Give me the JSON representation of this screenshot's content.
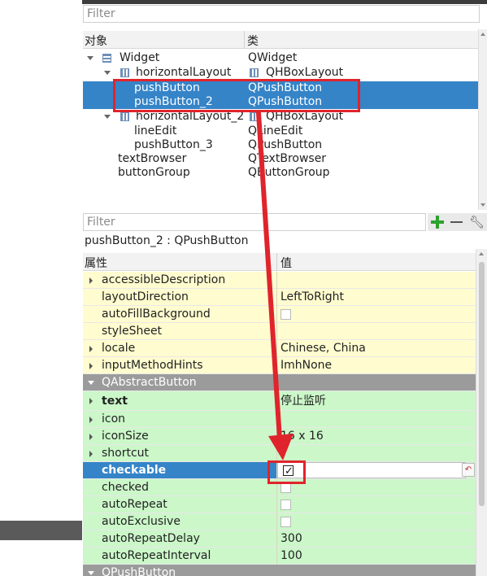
{
  "object_inspector": {
    "filter_placeholder": "Filter",
    "col_object": "对象",
    "col_class": "类",
    "rows": [
      {
        "name": "Widget",
        "cls": "QWidget"
      },
      {
        "name": "horizontalLayout",
        "cls": "QHBoxLayout"
      },
      {
        "name": "pushButton",
        "cls": "QPushButton"
      },
      {
        "name": "pushButton_2",
        "cls": "QPushButton"
      },
      {
        "name": "horizontalLayout_2",
        "cls": "QHBoxLayout"
      },
      {
        "name": "lineEdit",
        "cls": "QLineEdit"
      },
      {
        "name": "pushButton_3",
        "cls": "QPushButton"
      },
      {
        "name": "textBrowser",
        "cls": "QTextBrowser"
      },
      {
        "name": "buttonGroup",
        "cls": "QButtonGroup"
      }
    ]
  },
  "property_editor": {
    "filter_placeholder": "Filter",
    "object_label": "pushButton_2 : QPushButton",
    "col_property": "属性",
    "col_value": "值",
    "rows": [
      {
        "name": "accessibleDescription",
        "value": ""
      },
      {
        "name": "layoutDirection",
        "value": "LeftToRight"
      },
      {
        "name": "autoFillBackground",
        "value": ""
      },
      {
        "name": "styleSheet",
        "value": ""
      },
      {
        "name": "locale",
        "value": "Chinese, China"
      },
      {
        "name": "inputMethodHints",
        "value": "ImhNone"
      },
      {
        "name": "QAbstractButton",
        "value": ""
      },
      {
        "name": "text",
        "value": "停止监听"
      },
      {
        "name": "icon",
        "value": ""
      },
      {
        "name": "iconSize",
        "value": "16 x 16"
      },
      {
        "name": "shortcut",
        "value": ""
      },
      {
        "name": "checkable",
        "value": ""
      },
      {
        "name": "checked",
        "value": ""
      },
      {
        "name": "autoRepeat",
        "value": ""
      },
      {
        "name": "autoExclusive",
        "value": ""
      },
      {
        "name": "autoRepeatDelay",
        "value": "300"
      },
      {
        "name": "autoRepeatInterval",
        "value": "100"
      },
      {
        "name": "QPushButton",
        "value": ""
      }
    ],
    "checkable_checked": true
  },
  "colors": {
    "selection": "#3584c8",
    "annotation_red": "#e0242c",
    "row_yellow": "#fffccf",
    "row_green": "#cbf7c9",
    "group_gray": "#9b9b9b"
  },
  "icons": {
    "add_property": "plus-icon",
    "remove_property": "minus-icon",
    "configure": "wrench-icon",
    "reset": "reset-arrow-icon"
  }
}
